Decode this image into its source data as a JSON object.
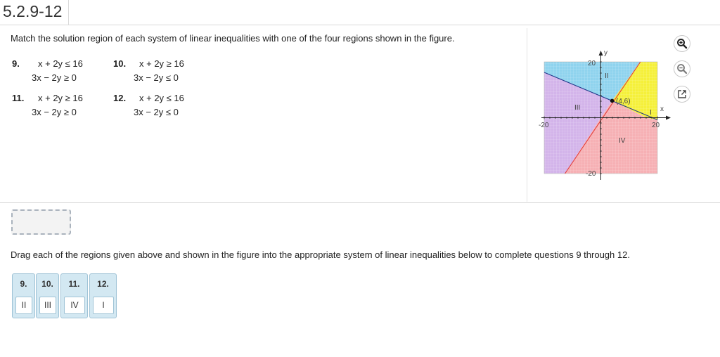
{
  "header": {
    "title": "5.2.9-12"
  },
  "question": {
    "text": "Match the solution region of each system of linear inequalities with one of the four regions shown in the figure."
  },
  "problems": [
    {
      "number": "9.",
      "line1": "x + 2y ≤ 16",
      "line2": "3x − 2y ≥ 0"
    },
    {
      "number": "10.",
      "line1": "x + 2y ≥ 16",
      "line2": "3x − 2y ≤ 0"
    },
    {
      "number": "11.",
      "line1": "x + 2y ≥ 16",
      "line2": "3x − 2y ≥ 0"
    },
    {
      "number": "12.",
      "line1": "x + 2y ≤ 16",
      "line2": "3x − 2y ≤ 0"
    }
  ],
  "figure": {
    "axis_x_label": "x",
    "axis_y_label": "y",
    "tick_top": "20",
    "tick_bottom": "-20",
    "tick_left": "-20",
    "tick_right": "20",
    "point_label": "(4,6)",
    "region_labels": [
      "I",
      "II",
      "III",
      "IV"
    ],
    "colors": {
      "region_I": "#f5f03a",
      "region_II": "#8fd3ee",
      "region_III": "#d3b4ea",
      "region_IV": "#f6b0b4",
      "line_red": "#e23b3b",
      "line_blue": "#233a8a"
    }
  },
  "tools": [
    {
      "name": "zoom-in-icon"
    },
    {
      "name": "zoom-out-icon"
    },
    {
      "name": "popout-icon"
    }
  ],
  "instruction": "Drag each of the regions given above and shown in the figure into the appropriate system of linear inequalities below to complete questions 9 through 12.",
  "answers": [
    {
      "question": "9.",
      "value": "II"
    },
    {
      "question": "10.",
      "value": "III"
    },
    {
      "question": "11.",
      "value": "IV"
    },
    {
      "question": "12.",
      "value": "I"
    }
  ]
}
